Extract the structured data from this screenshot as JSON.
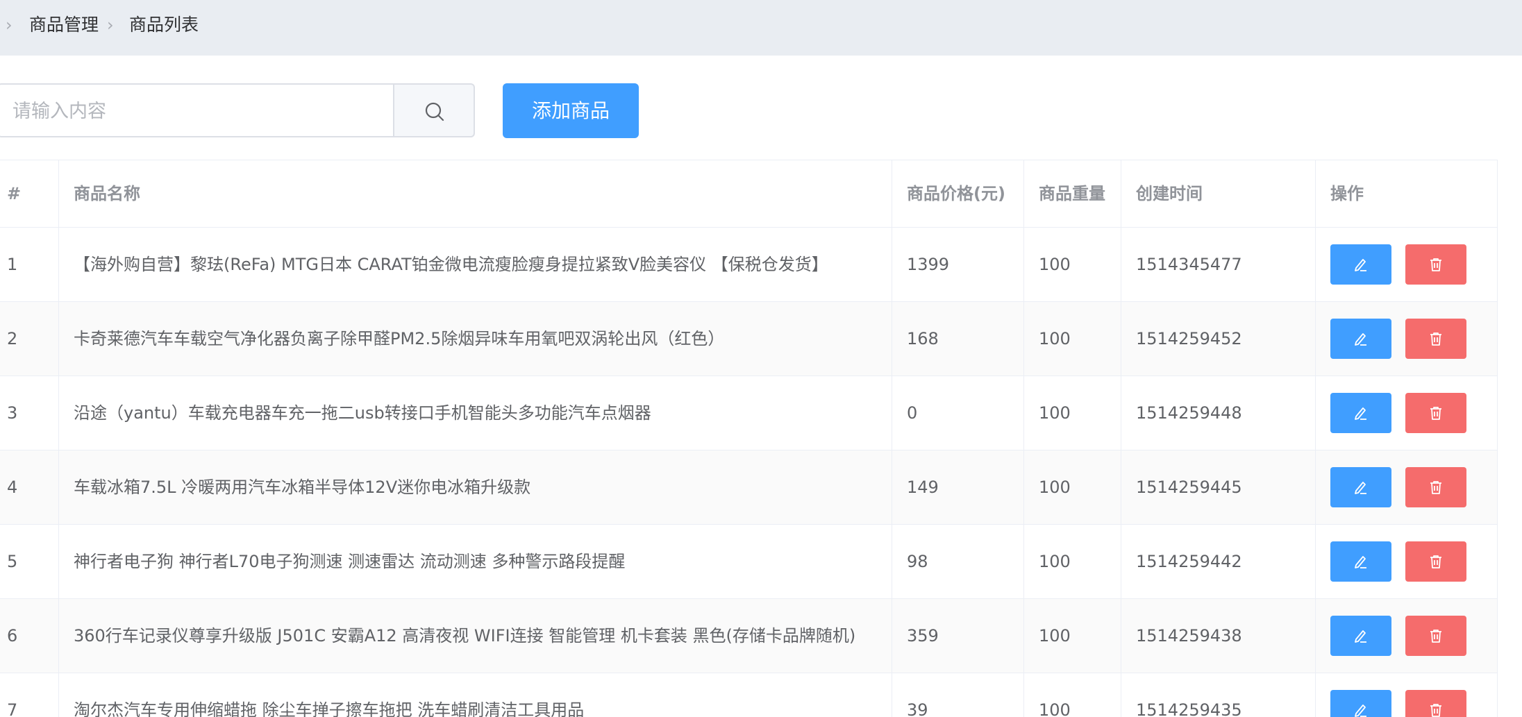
{
  "breadcrumb": {
    "items": [
      "商品管理",
      "商品列表"
    ]
  },
  "toolbar": {
    "search_placeholder": "请输入内容",
    "search_value": "",
    "add_label": "添加商品"
  },
  "table": {
    "columns": [
      "#",
      "商品名称",
      "商品价格(元)",
      "商品重量",
      "创建时间",
      "操作"
    ],
    "rows": [
      [
        "1",
        "【海外购自营】黎珐(ReFa) MTG日本 CARAT铂金微电流瘦脸瘦身提拉紧致V脸美容仪 【保税仓发货】",
        "1399",
        "100",
        "1514345477"
      ],
      [
        "2",
        "卡奇莱德汽车车载空气净化器负离子除甲醛PM2.5除烟异味车用氧吧双涡轮出风（红色）",
        "168",
        "100",
        "1514259452"
      ],
      [
        "3",
        "沿途（yantu）车载充电器车充一拖二usb转接口手机智能头多功能汽车点烟器",
        "0",
        "100",
        "1514259448"
      ],
      [
        "4",
        "车载冰箱7.5L 冷暖两用汽车冰箱半导体12V迷你电冰箱升级款",
        "149",
        "100",
        "1514259445"
      ],
      [
        "5",
        "神行者电子狗 神行者L70电子狗测速 测速雷达 流动测速 多种警示路段提醒",
        "98",
        "100",
        "1514259442"
      ],
      [
        "6",
        "360行车记录仪尊享升级版 J501C 安霸A12 高清夜视 WIFI连接 智能管理 机卡套装 黑色(存储卡品牌随机)",
        "359",
        "100",
        "1514259438"
      ],
      [
        "7",
        "淘尔杰汽车专用伸缩蜡拖 除尘车掸子擦车拖把 洗车蜡刷清洁工具用品",
        "39",
        "100",
        "1514259435"
      ]
    ]
  },
  "colors": {
    "primary": "#409eff",
    "danger": "#f56c6c",
    "header_bg": "#e9edf2",
    "border": "#ebeef5"
  },
  "icons": {
    "edit": "edit-icon",
    "delete": "delete-icon",
    "search": "search-icon",
    "breadcrumb_separator": "chevron-right-icon"
  }
}
